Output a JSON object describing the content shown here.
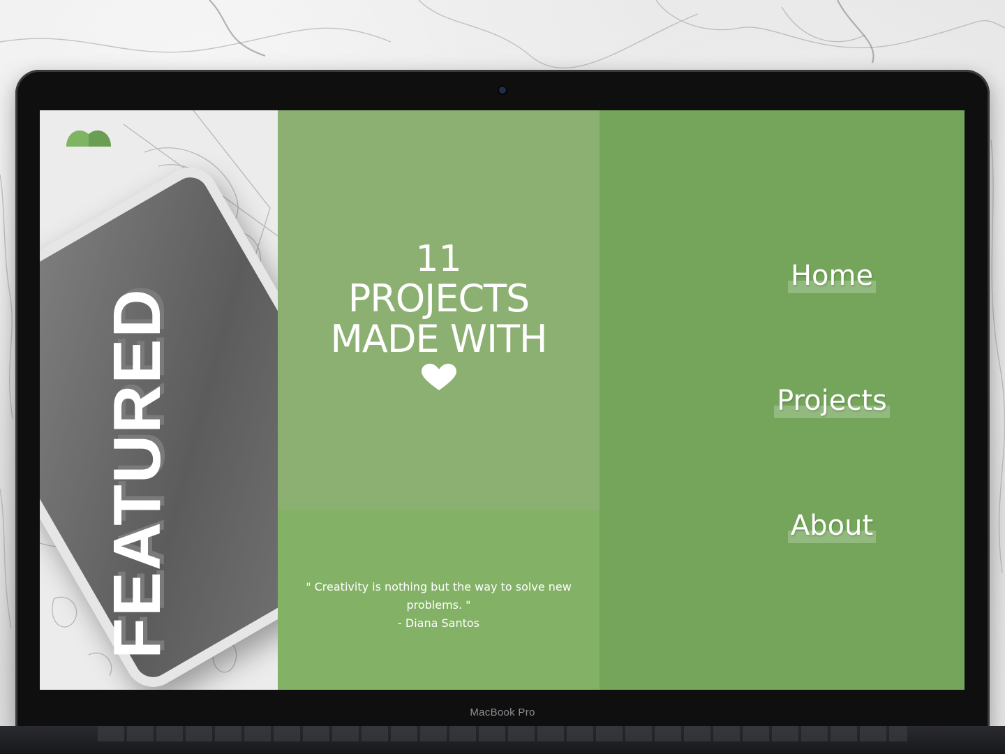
{
  "device": {
    "brand_label": "MacBook Pro"
  },
  "colors": {
    "accent_green": "#74a55a",
    "center_top_green": "#8cb071",
    "center_bottom_green": "#83b166",
    "text_white": "#ffffff"
  },
  "hero": {
    "vertical_title": "FEATURED",
    "logo_icon": "leaf-logo-icon"
  },
  "headline": {
    "count": "11",
    "line1": "PROJECTS",
    "line2": "MADE WITH",
    "icon": "heart-icon"
  },
  "quote": {
    "text": "\" Creativity is nothing but the way to solve new problems. \"",
    "author": "- Diana Santos"
  },
  "nav": {
    "items": [
      {
        "label": "Home"
      },
      {
        "label": "Projects"
      },
      {
        "label": "About"
      }
    ]
  }
}
